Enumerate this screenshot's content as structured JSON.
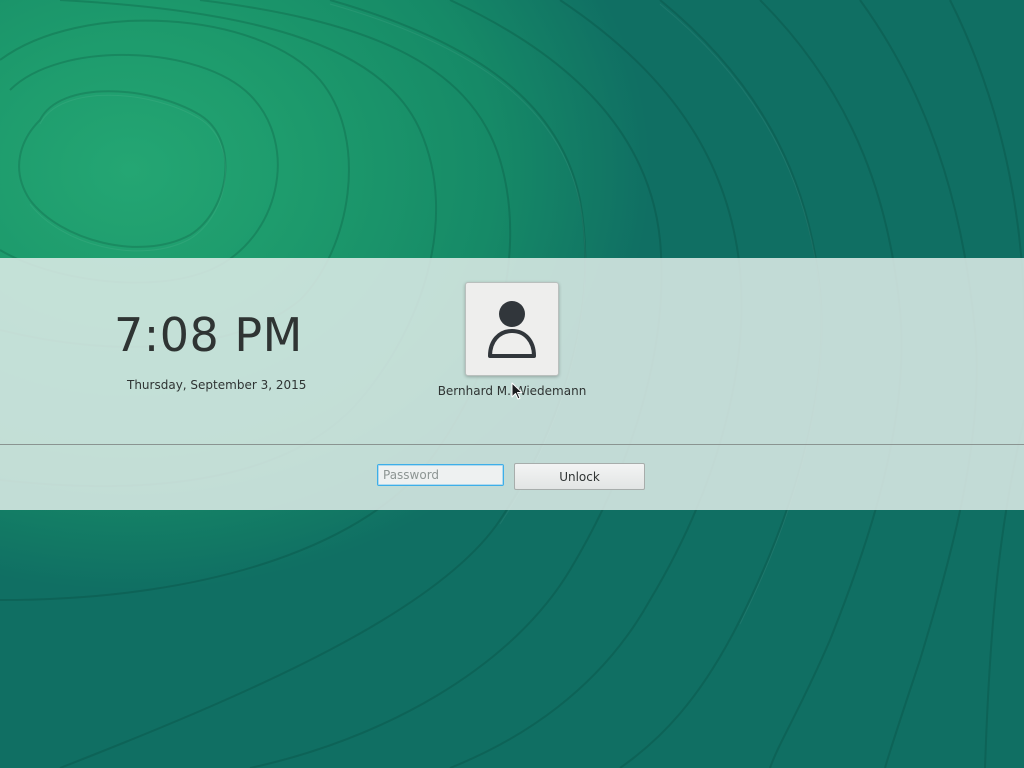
{
  "lock_screen": {
    "clock": {
      "time": "7:08 PM",
      "date": "Thursday, September 3, 2015"
    },
    "user": {
      "name": "Bernhard M. Wiedemann",
      "avatar_icon": "user-silhouette-icon"
    },
    "password": {
      "placeholder": "Password",
      "value": ""
    },
    "unlock_label": "Unlock"
  },
  "theme": {
    "wallpaper_light": "#24a673",
    "wallpaper_dark": "#106f63",
    "panel_color": "#dfece9",
    "focus_color": "#3daee9",
    "text_color": "#2f3433"
  },
  "cursor_icon": "arrow-pointer-icon"
}
